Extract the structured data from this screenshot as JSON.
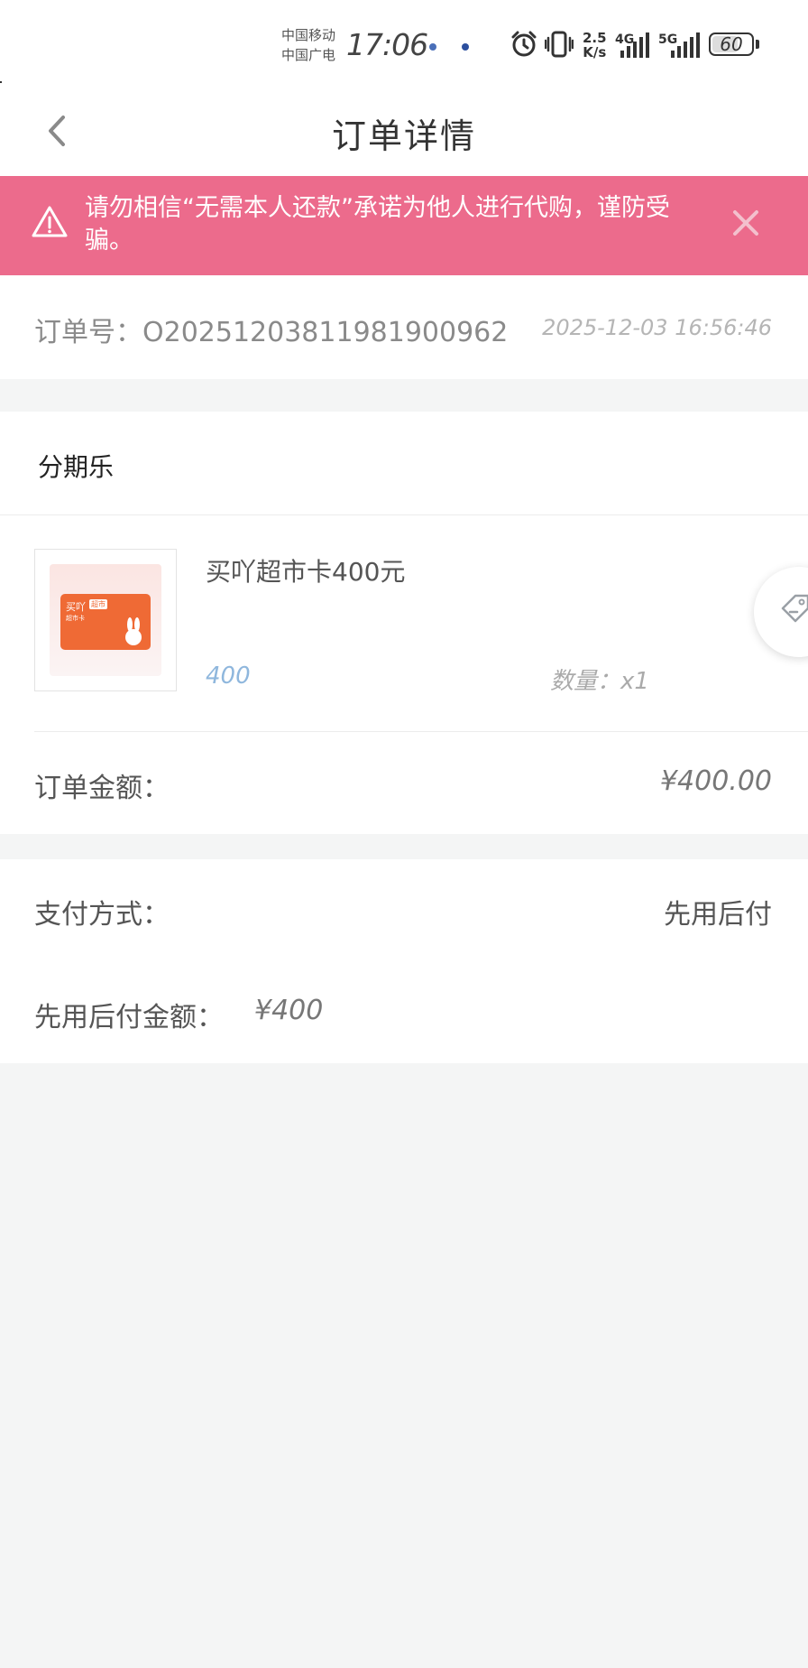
{
  "status_bar": {
    "carrier_1": "中国移动",
    "carrier_2": "中国广电",
    "time": "17:06",
    "net_speed_value": "2.5",
    "net_speed_unit": "K/s",
    "signal_1_label": "4G",
    "signal_2_label": "5G",
    "battery_level": "60",
    "icons": [
      "alarm-icon",
      "vibrate-icon"
    ]
  },
  "nav": {
    "title": "订单详情",
    "back_icon": "chevron-left-icon"
  },
  "warning": {
    "text": "请勿相信“无需本人还款”承诺为他人进行代购，谨防受骗。",
    "icon": "warning-triangle-icon",
    "close_icon": "close-icon",
    "background": "#ec6b8c"
  },
  "order": {
    "number_label": "订单号：",
    "number": "O202512038119819​00962",
    "time": "2025-12-03 16:56:46"
  },
  "shop": {
    "name": "分期乐"
  },
  "product": {
    "title": "买吖超市卡400元",
    "price": "400",
    "qty_label": "数量：",
    "qty": "x1",
    "thumb_brand": "买吖",
    "thumb_tag": "超市",
    "thumb_sub": "超市卡",
    "price_color": "#8fb7dd"
  },
  "amount": {
    "label": "订单金额：",
    "value": "¥400.00"
  },
  "payment": {
    "method_label": "支付方式：",
    "method_value": "先用后付",
    "bnpl_label": "先用后付金额：",
    "bnpl_value": "¥400"
  },
  "float_button": {
    "icon": "price-tag-icon"
  }
}
